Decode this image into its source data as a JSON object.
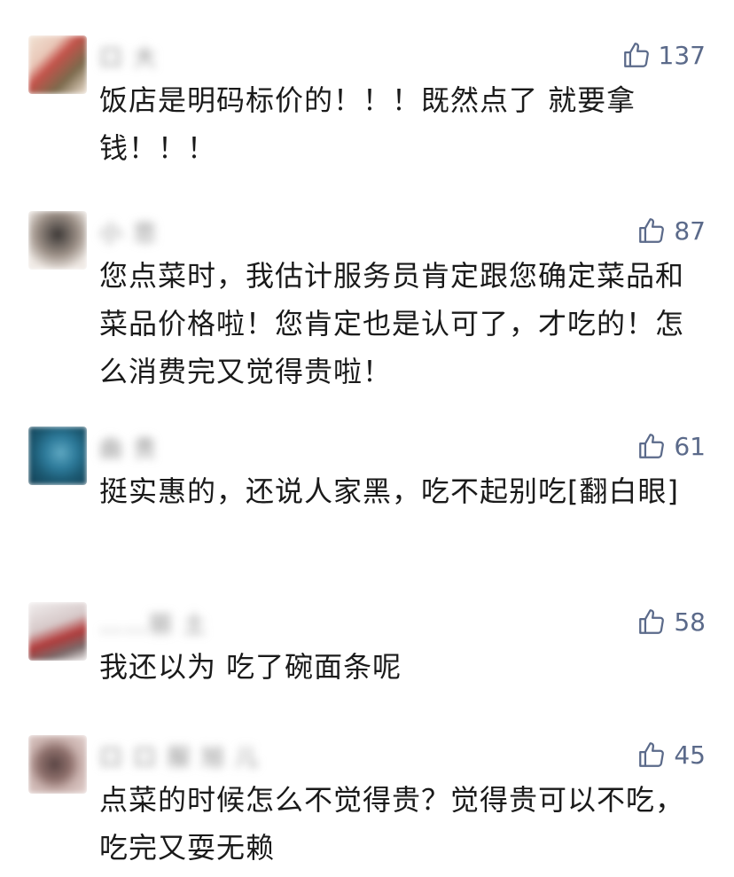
{
  "colors": {
    "like_blue": "#5b6a8a",
    "text": "#1a1a1a",
    "name_gray": "#8a8a8a"
  },
  "comments": [
    {
      "name": "口 大",
      "likes": "137",
      "text": "饭店是明码标价的！！！既然点了 就要拿钱！！！",
      "avatar_icon": "pixelated-avatar",
      "avatar_colors": [
        "#e9c7b8",
        "#c4524a",
        "#7b6a4c",
        "#f1e3d4"
      ]
    },
    {
      "name": "小 悲",
      "likes": "87",
      "text": "您点菜时，我估计服务员肯定跟您确定菜品和菜品价格啦！您肯定也是认可了，才吃的！怎么消费完又觉得贵啦！",
      "avatar_icon": "pixelated-avatar",
      "avatar_colors": [
        "#d9d2cc",
        "#3c3836",
        "#9b8f86",
        "#efe9e4"
      ]
    },
    {
      "name": "曲 贵",
      "likes": "61",
      "text": "挺实惠的，还说人家黑，吃不起别吃[翻白眼]",
      "avatar_icon": "pixelated-avatar",
      "avatar_colors": [
        "#2d7a9a",
        "#123d52",
        "#5fa8c2",
        "#1c5a73"
      ]
    },
    {
      "name": "……丽 土",
      "likes": "58",
      "text": "我还以为 吃了碗面条呢",
      "avatar_icon": "pixelated-avatar",
      "avatar_colors": [
        "#f1eeee",
        "#b13a3a",
        "#d6c8c8",
        "#7a6a6a"
      ]
    },
    {
      "name": "口 口 服 旭 儿",
      "likes": "45",
      "text": "点菜的时候怎么不觉得贵？觉得贵可以不吃，吃完又耍无赖",
      "avatar_icon": "pixelated-avatar",
      "avatar_colors": [
        "#c9b1ad",
        "#5a4544",
        "#e6d5d2",
        "#8d6f6b"
      ]
    }
  ]
}
